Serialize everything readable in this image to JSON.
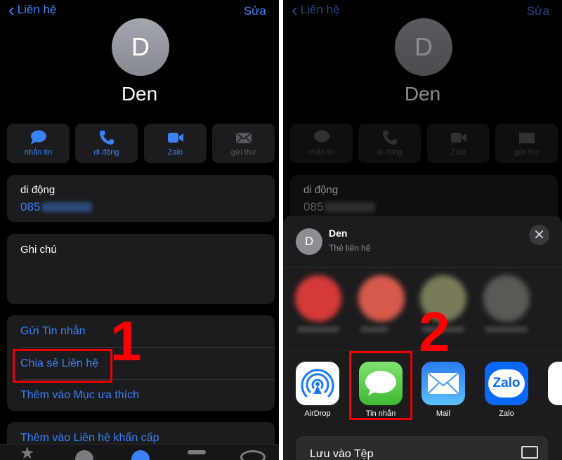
{
  "contact": {
    "back_label": "Liên hệ",
    "edit_label": "Sửa",
    "initial": "D",
    "name": "Den",
    "actions": [
      {
        "label": "nhắn tin",
        "icon": "message-icon"
      },
      {
        "label": "di động",
        "icon": "phone-icon"
      },
      {
        "label": "Zalo",
        "icon": "video-icon"
      },
      {
        "label": "gửi thư",
        "icon": "mail-icon"
      }
    ],
    "phone_label": "di động",
    "phone_prefix": "085",
    "notes_label": "Ghi chú",
    "links": [
      "Gửi Tin nhắn",
      "Chia sẻ Liên hệ",
      "Thêm vào Mục ưa thích"
    ],
    "emergency_link": "Thêm vào Liên hệ khẩn cấp"
  },
  "share_sheet": {
    "name": "Den",
    "subtitle": "Thẻ liên hệ",
    "initial": "D",
    "apps": [
      {
        "label": "AirDrop"
      },
      {
        "label": "Tin nhắn"
      },
      {
        "label": "Mail"
      },
      {
        "label": "Zalo",
        "logo": "Zalo"
      }
    ],
    "save_to_files": "Lưu vào Tệp"
  },
  "annotations": {
    "step1": "1",
    "step2": "2"
  },
  "colors": {
    "accent": "#3a82f7",
    "annotation": "#ff0000",
    "messages_green": "#5ac94f"
  }
}
